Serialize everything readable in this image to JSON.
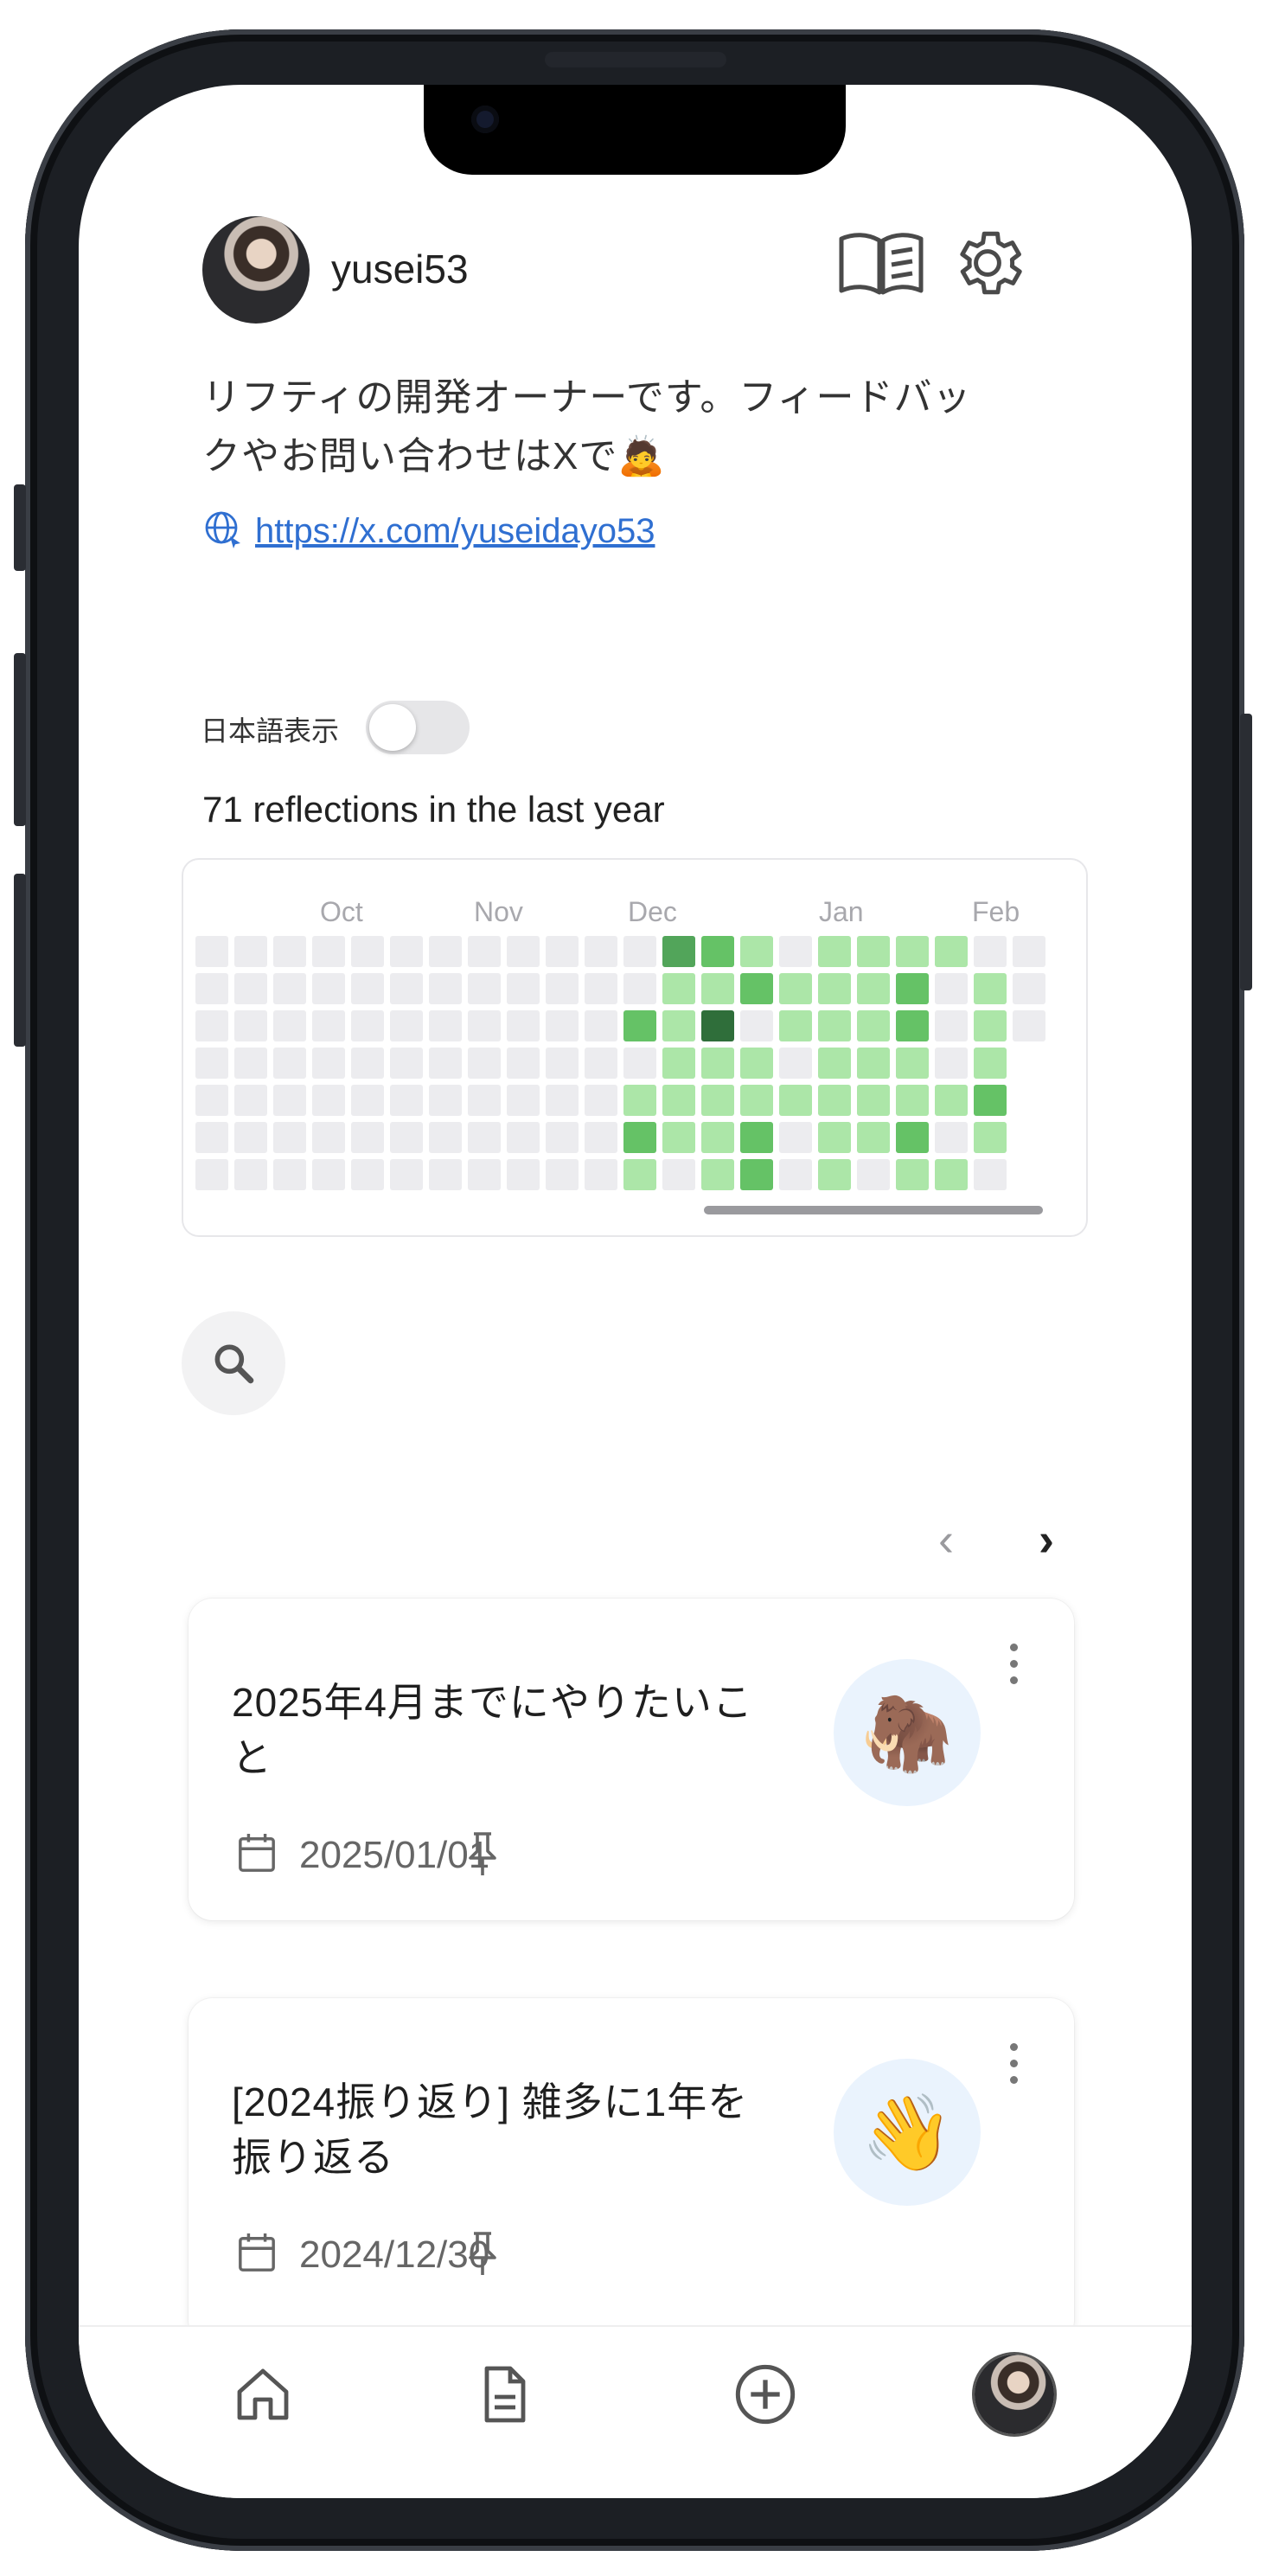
{
  "profile": {
    "username": "yusei53",
    "bio_line1": "リフティの開発オーナーです。フィードバッ",
    "bio_line2": "クやお問い合わせはXで🙇",
    "link_text": "https://x.com/yuseidayo53"
  },
  "header_icons": [
    "book-icon",
    "gear-icon"
  ],
  "language_toggle": {
    "label": "日本語表示",
    "on": false
  },
  "activity": {
    "summary": "71 reflections in the last year",
    "months": [
      "Oct",
      "Nov",
      "Dec",
      "Jan",
      "Feb"
    ],
    "levels": [
      [
        0,
        0,
        0,
        0,
        0,
        0,
        0,
        0,
        0,
        0,
        0,
        0,
        3,
        2,
        1,
        0,
        1,
        1,
        1,
        1,
        0,
        0
      ],
      [
        0,
        0,
        0,
        0,
        0,
        0,
        0,
        0,
        0,
        0,
        0,
        0,
        1,
        1,
        2,
        1,
        1,
        1,
        2,
        0,
        1,
        0
      ],
      [
        0,
        0,
        0,
        0,
        0,
        0,
        0,
        0,
        0,
        0,
        0,
        2,
        1,
        4,
        0,
        1,
        1,
        1,
        2,
        0,
        1,
        0
      ],
      [
        0,
        0,
        0,
        0,
        0,
        0,
        0,
        0,
        0,
        0,
        0,
        0,
        1,
        1,
        1,
        0,
        1,
        1,
        1,
        0,
        1
      ],
      [
        0,
        0,
        0,
        0,
        0,
        0,
        0,
        0,
        0,
        0,
        0,
        1,
        1,
        1,
        1,
        1,
        1,
        1,
        1,
        1,
        2
      ],
      [
        0,
        0,
        0,
        0,
        0,
        0,
        0,
        0,
        0,
        0,
        0,
        2,
        1,
        1,
        2,
        0,
        1,
        1,
        2,
        0,
        1
      ],
      [
        0,
        0,
        0,
        0,
        0,
        0,
        0,
        0,
        0,
        0,
        0,
        1,
        0,
        1,
        2,
        0,
        1,
        0,
        1,
        1,
        0
      ]
    ],
    "level_colors": [
      "#ececef",
      "#ace6a8",
      "#65c266",
      "#52a55a",
      "#2f6e3a"
    ]
  },
  "pager": {
    "prev": "‹",
    "next": "›"
  },
  "reflections": [
    {
      "title_line1": "2025年4月までにやりたいこ",
      "title_line2": "と",
      "date": "2025/01/01",
      "emoji": "🦣"
    },
    {
      "title_line1": "[2024振り返り] 雑多に1年を",
      "title_line2": "振り返る",
      "date": "2024/12/30",
      "emoji": "👋"
    }
  ],
  "bottom_nav": [
    "home-icon",
    "document-icon",
    "add-icon",
    "profile-avatar"
  ]
}
